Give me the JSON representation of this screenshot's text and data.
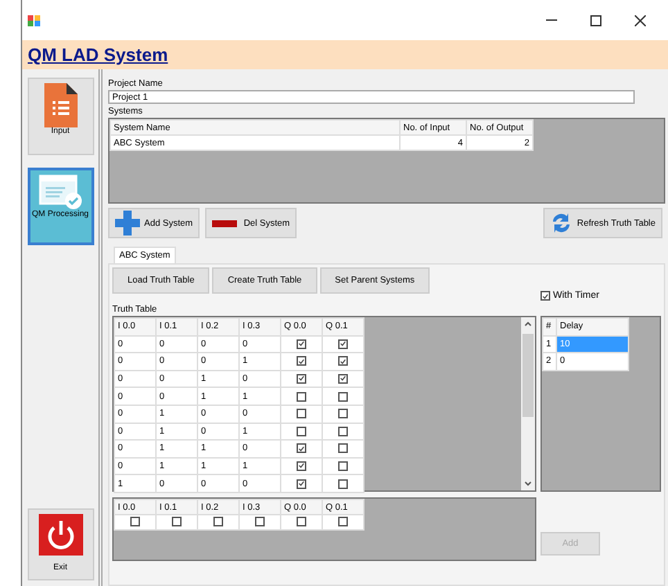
{
  "window": {
    "title": "QM LAD System"
  },
  "sidebar": {
    "items": [
      {
        "label": "Input",
        "kind": "document",
        "selected": false
      },
      {
        "label": "QM Processing",
        "kind": "processing",
        "selected": true
      }
    ],
    "exit": {
      "label": "Exit"
    }
  },
  "project": {
    "label": "Project Name",
    "value": "Project 1"
  },
  "systems": {
    "label": "Systems",
    "columns": [
      "System Name",
      "No. of Input",
      "No. of Output"
    ],
    "rows": [
      [
        "ABC System",
        "4",
        "2"
      ]
    ]
  },
  "system_buttons": {
    "add": "Add System",
    "del": "Del System",
    "refresh": "Refresh Truth Table"
  },
  "tabs": [
    {
      "label": "ABC System",
      "selected": true
    }
  ],
  "tab_buttons": [
    "Load Truth Table",
    "Create Truth Table",
    "Set Parent Systems"
  ],
  "truth_table": {
    "label": "Truth Table",
    "inputs": [
      "I 0.0",
      "I 0.1",
      "I 0.2",
      "I 0.3"
    ],
    "outputs": [
      "Q 0.0",
      "Q 0.1"
    ],
    "rows": [
      {
        "inputs": [
          "0",
          "0",
          "0",
          "0"
        ],
        "outputs": [
          true,
          true
        ]
      },
      {
        "inputs": [
          "0",
          "0",
          "0",
          "1"
        ],
        "outputs": [
          true,
          true
        ]
      },
      {
        "inputs": [
          "0",
          "0",
          "1",
          "0"
        ],
        "outputs": [
          true,
          true
        ]
      },
      {
        "inputs": [
          "0",
          "0",
          "1",
          "1"
        ],
        "outputs": [
          false,
          false
        ]
      },
      {
        "inputs": [
          "0",
          "1",
          "0",
          "0"
        ],
        "outputs": [
          false,
          false
        ]
      },
      {
        "inputs": [
          "0",
          "1",
          "0",
          "1"
        ],
        "outputs": [
          false,
          false
        ]
      },
      {
        "inputs": [
          "0",
          "1",
          "1",
          "0"
        ],
        "outputs": [
          true,
          false
        ]
      },
      {
        "inputs": [
          "0",
          "1",
          "1",
          "1"
        ],
        "outputs": [
          true,
          false
        ]
      },
      {
        "inputs": [
          "1",
          "0",
          "0",
          "0"
        ],
        "outputs": [
          true,
          false
        ]
      }
    ]
  },
  "timer": {
    "label": "With Timer",
    "checked": true,
    "columns": [
      "#",
      "Delay"
    ],
    "rows": [
      {
        "index": "1",
        "delay": "10",
        "selected": true
      },
      {
        "index": "2",
        "delay": "0",
        "selected": false
      }
    ],
    "add": {
      "label": "Add",
      "disabled": true
    }
  },
  "new_row": {
    "columns": [
      "I 0.0",
      "I 0.1",
      "I 0.2",
      "I 0.3",
      "Q 0.0",
      "Q 0.1"
    ],
    "checks": [
      false,
      false,
      false,
      false,
      false,
      false
    ]
  }
}
